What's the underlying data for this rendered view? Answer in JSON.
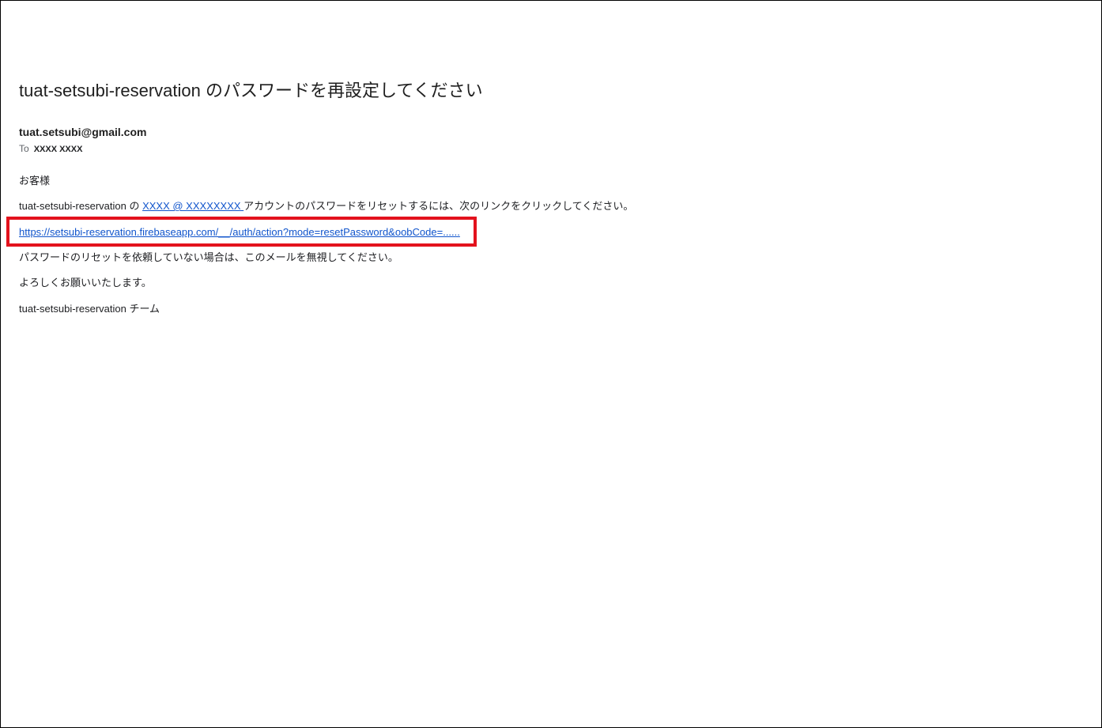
{
  "email": {
    "subject": "tuat-setsubi-reservation のパスワードを再設定してください",
    "sender": "tuat.setsubi@gmail.com",
    "to_label": "To",
    "to_name": "XXXX XXXX",
    "greeting": "お客様",
    "body_prefix": "tuat-setsubi-reservation の",
    "account_link": " XXXX @ XXXXXXXX ",
    "body_suffix": "アカウントのパスワードをリセットするには、次のリンクをクリックしてください。",
    "reset_link": "https://setsubi-reservation.firebaseapp.com/__/auth/action?mode=resetPassword&oobCode=......",
    "ignore_note": "パスワードのリセットを依頼していない場合は、このメールを無視してください。",
    "regards": "よろしくお願いいたします。",
    "signature": "tuat-setsubi-reservation チーム"
  },
  "colors": {
    "link": "#1155cc",
    "highlight": "#e3121d",
    "text": "#202124"
  }
}
